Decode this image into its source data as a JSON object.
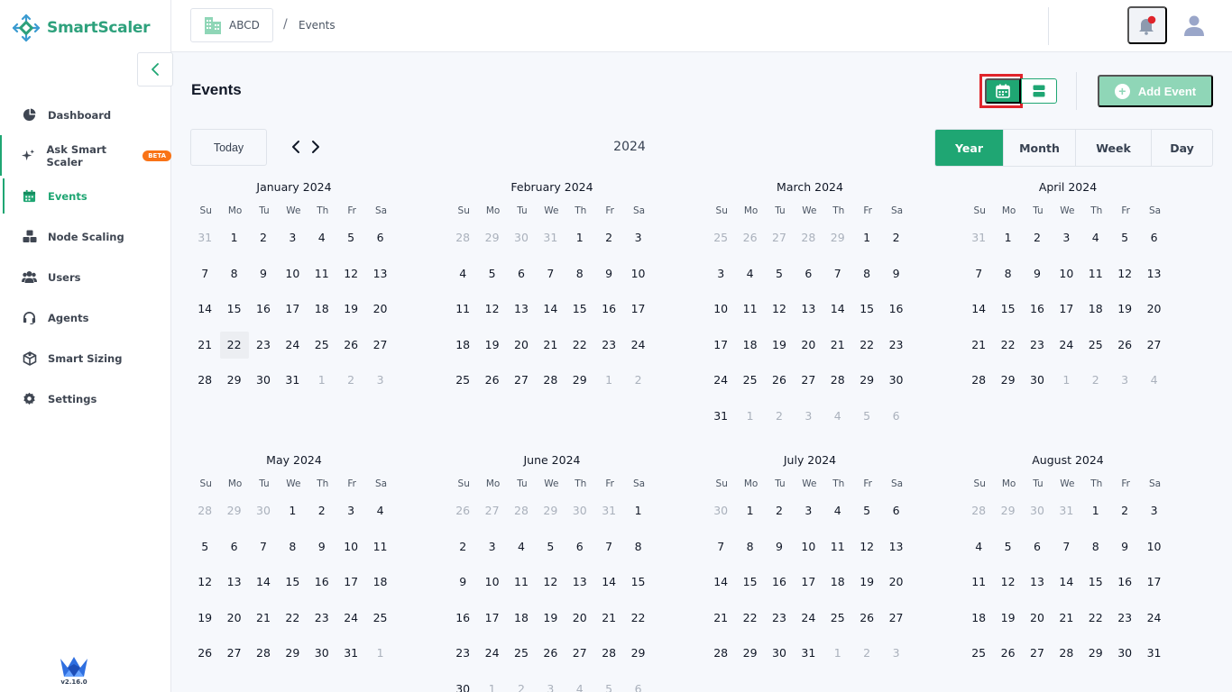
{
  "app": {
    "name": "SmartScaler",
    "version": "v2.16.0"
  },
  "sidebar": {
    "items": [
      {
        "label": "Dashboard",
        "icon": "pie-chart-icon"
      },
      {
        "label": "Ask Smart Scaler",
        "icon": "sparkle-icon",
        "badge": "BETA"
      },
      {
        "label": "Events",
        "icon": "calendar-icon",
        "active": true
      },
      {
        "label": "Node Scaling",
        "icon": "nodes-icon"
      },
      {
        "label": "Users",
        "icon": "users-icon"
      },
      {
        "label": "Agents",
        "icon": "headset-icon"
      },
      {
        "label": "Smart Sizing",
        "icon": "sizing-icon"
      },
      {
        "label": "Settings",
        "icon": "gear-icon"
      }
    ]
  },
  "header": {
    "org": "ABCD",
    "separator": "/",
    "current": "Events"
  },
  "main": {
    "title": "Events",
    "add_event": "Add Event",
    "today": "Today",
    "year": "2024",
    "ranges": [
      "Year",
      "Month",
      "Week",
      "Day"
    ],
    "active_range": "Year"
  },
  "calendar": {
    "weekdays": [
      "Su",
      "Mo",
      "Tu",
      "We",
      "Th",
      "Fr",
      "Sa"
    ],
    "today_date": "2024-01-22",
    "months": [
      {
        "title": "January 2024"
      },
      {
        "title": "February 2024"
      },
      {
        "title": "March 2024"
      },
      {
        "title": "April 2024"
      },
      {
        "title": "May 2024"
      },
      {
        "title": "June 2024"
      },
      {
        "title": "July 2024"
      },
      {
        "title": "August 2024"
      }
    ]
  },
  "colors": {
    "accent": "#1fa673",
    "accent_light": "#8fd6b7",
    "beta": "#f97316",
    "highlight_box": "#e0242b",
    "notification_dot": "#e0242b"
  }
}
